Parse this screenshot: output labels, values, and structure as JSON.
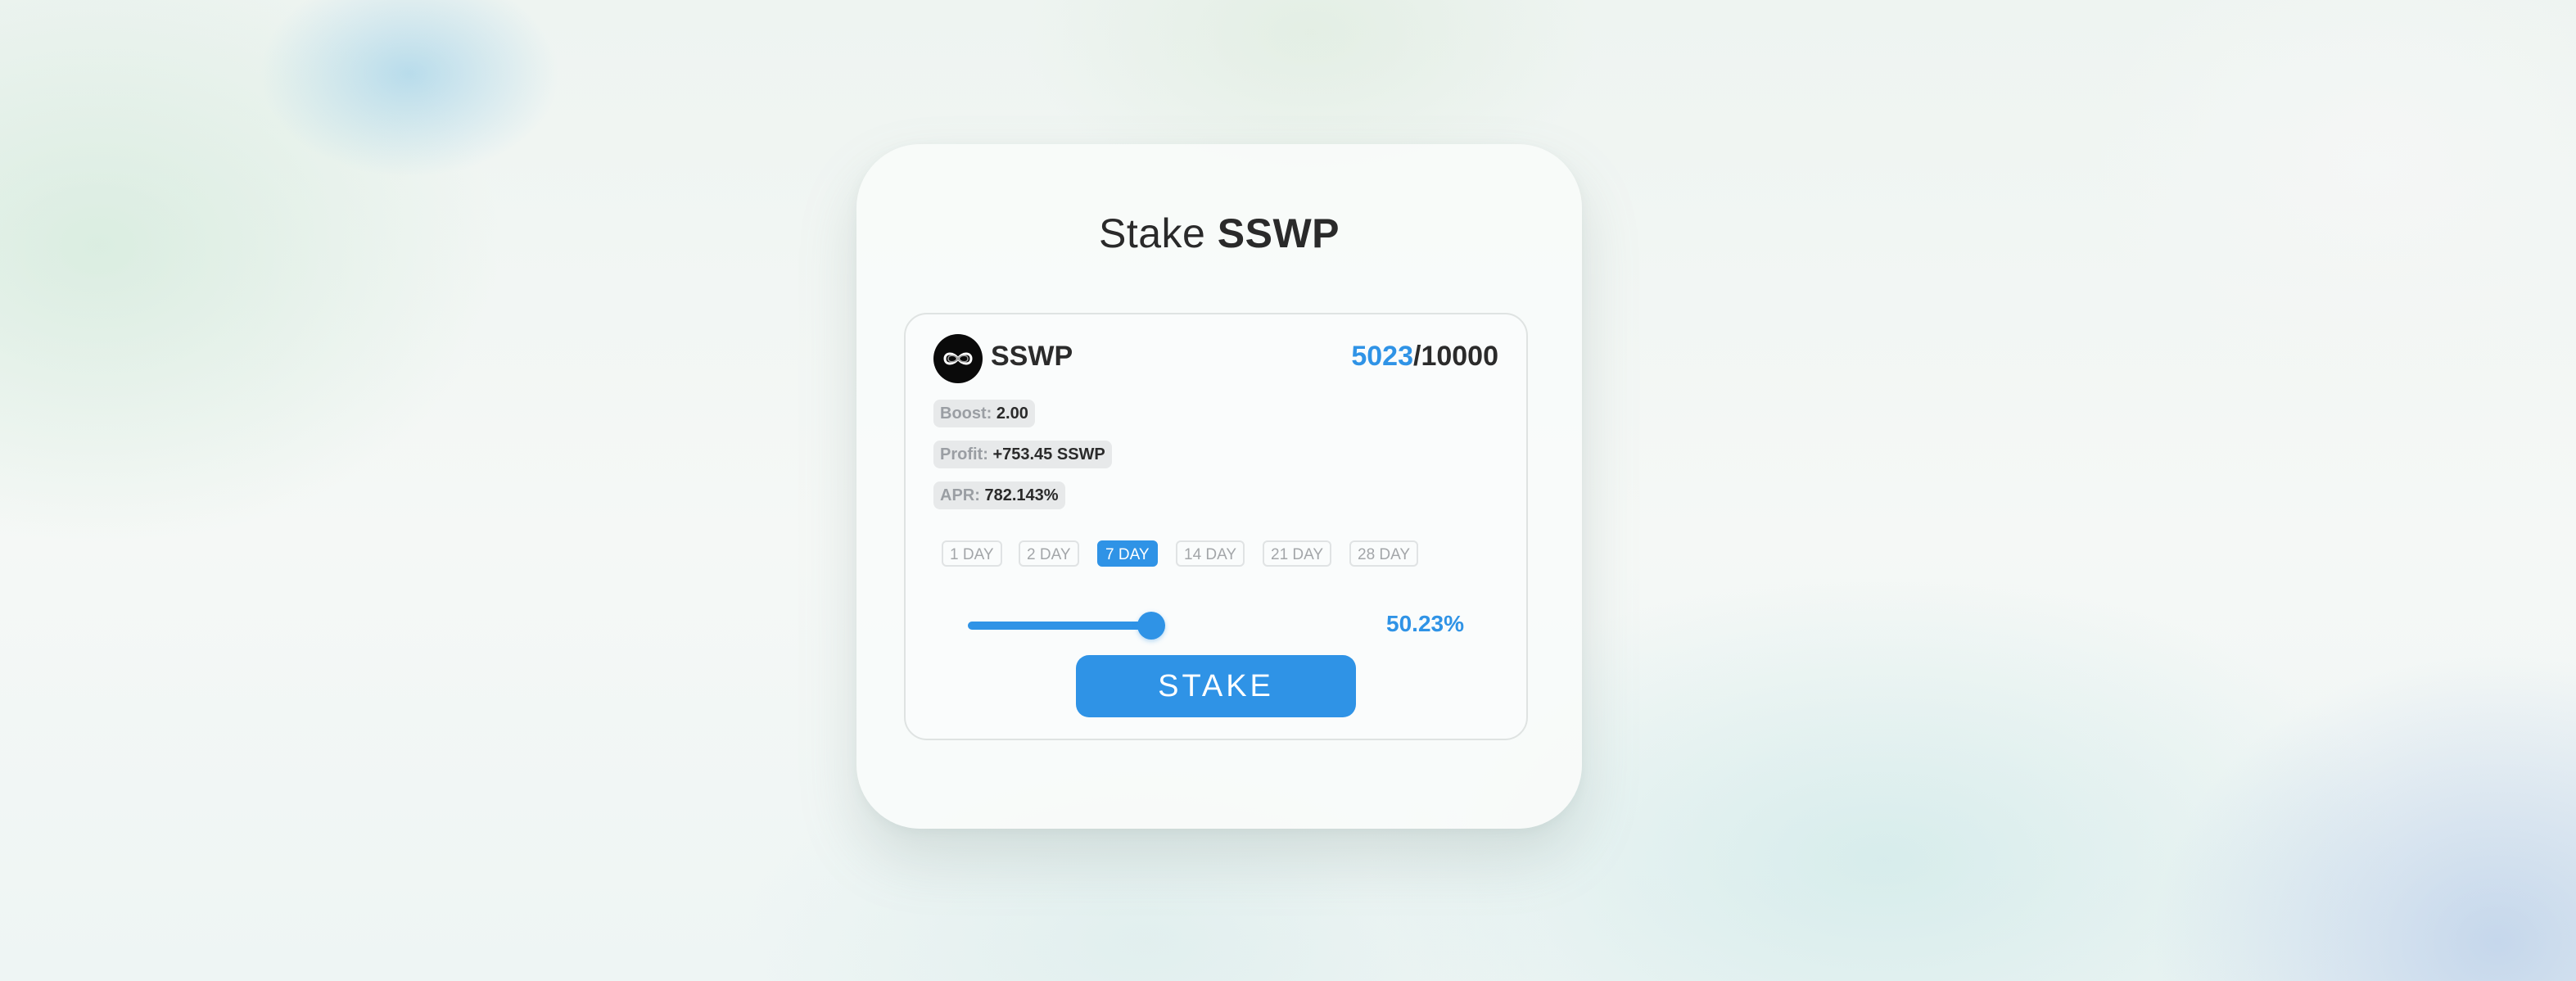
{
  "title": {
    "prefix": "Stake",
    "token": "SSWP"
  },
  "token": {
    "name": "SSWP",
    "icon": "infinity-icon",
    "current": "5023",
    "separator": "/",
    "total": "10000"
  },
  "stats": {
    "boost": {
      "label": "Boost:",
      "value": "2.00"
    },
    "profit": {
      "label": "Profit:",
      "value": "+753.45 SSWP"
    },
    "apr": {
      "label": "APR:",
      "value": "782.143%"
    }
  },
  "durations": {
    "options": [
      "1 DAY",
      "2 DAY",
      "7 DAY",
      "14 DAY",
      "21 DAY",
      "28 DAY"
    ],
    "selected": "7 DAY"
  },
  "slider": {
    "value_fraction": 0.5023,
    "label": "50.23%"
  },
  "stake_button": {
    "label": "STAKE"
  },
  "colors": {
    "accent": "#2f93e6",
    "text": "#2b2b2b",
    "muted": "#9a9ea3",
    "card": "#f8fbfa"
  }
}
